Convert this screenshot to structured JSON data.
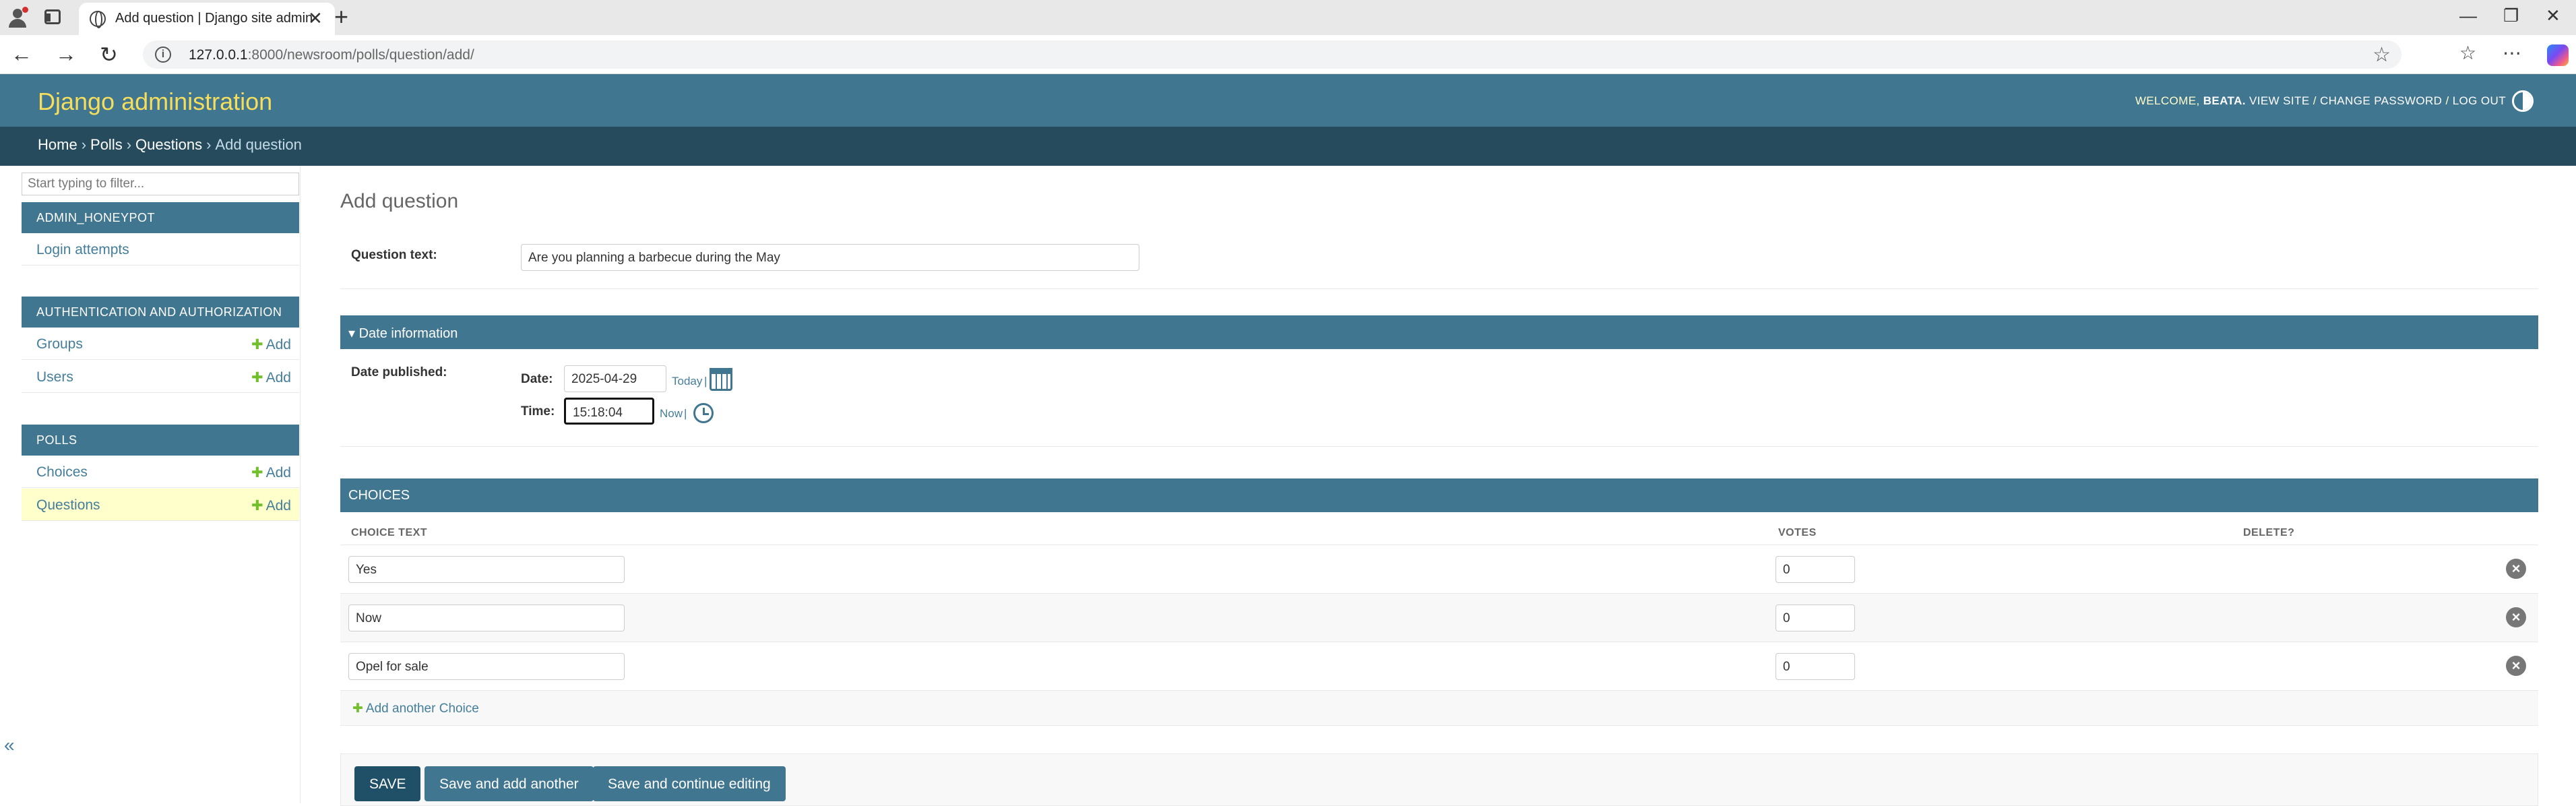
{
  "browser": {
    "tab_title": "Add question | Django site admin",
    "url_host": "127.0.0.1",
    "url_path": ":8000/newsroom/polls/question/add/"
  },
  "header": {
    "brand": "Django administration",
    "welcome": "WELCOME,",
    "username": "BEATA.",
    "view_site": "VIEW SITE",
    "change_password": "CHANGE PASSWORD",
    "log_out": "LOG OUT",
    "separator": "/"
  },
  "breadcrumbs": {
    "home": "Home",
    "polls": "Polls",
    "questions": "Questions",
    "current": "Add question",
    "sep": "›"
  },
  "sidebar": {
    "filter_placeholder": "Start typing to filter...",
    "collapse_glyph": "«",
    "modules": [
      {
        "caption": "ADMIN_HONEYPOT",
        "items": [
          {
            "label": "Login attempts",
            "add": ""
          }
        ]
      },
      {
        "caption": "AUTHENTICATION AND AUTHORIZATION",
        "items": [
          {
            "label": "Groups",
            "add": "Add"
          },
          {
            "label": "Users",
            "add": "Add"
          }
        ]
      },
      {
        "caption": "POLLS",
        "items": [
          {
            "label": "Choices",
            "add": "Add"
          },
          {
            "label": "Questions",
            "add": "Add",
            "current": true
          }
        ]
      }
    ]
  },
  "form": {
    "title": "Add question",
    "question_text_label": "Question text:",
    "question_text_value": "Are you planning a barbecue during the May",
    "date_section": "▾ Date information",
    "date_published_label": "Date published:",
    "date_label": "Date:",
    "date_value": "2025-04-29",
    "today_link": "Today",
    "time_label": "Time:",
    "time_value": "15:18:04",
    "now_link": "Now",
    "pipe": "|"
  },
  "choices": {
    "caption": "CHOICES",
    "col_choice_text": "CHOICE TEXT",
    "col_votes": "VOTES",
    "col_delete": "DELETE?",
    "rows": [
      {
        "text": "Yes",
        "votes": "0"
      },
      {
        "text": "Now",
        "votes": "0"
      },
      {
        "text": "Opel for sale",
        "votes": "0"
      }
    ],
    "add_another": "Add another Choice"
  },
  "submit": {
    "save": "SAVE",
    "save_add_another": "Save and add another",
    "save_continue": "Save and continue editing"
  },
  "colors": {
    "primary": "#417690",
    "secondary": "#264b5d",
    "accent": "#f5dd5d",
    "link": "#447e9b",
    "add_green": "#70bf2b",
    "current_row": "#ffffcc"
  }
}
